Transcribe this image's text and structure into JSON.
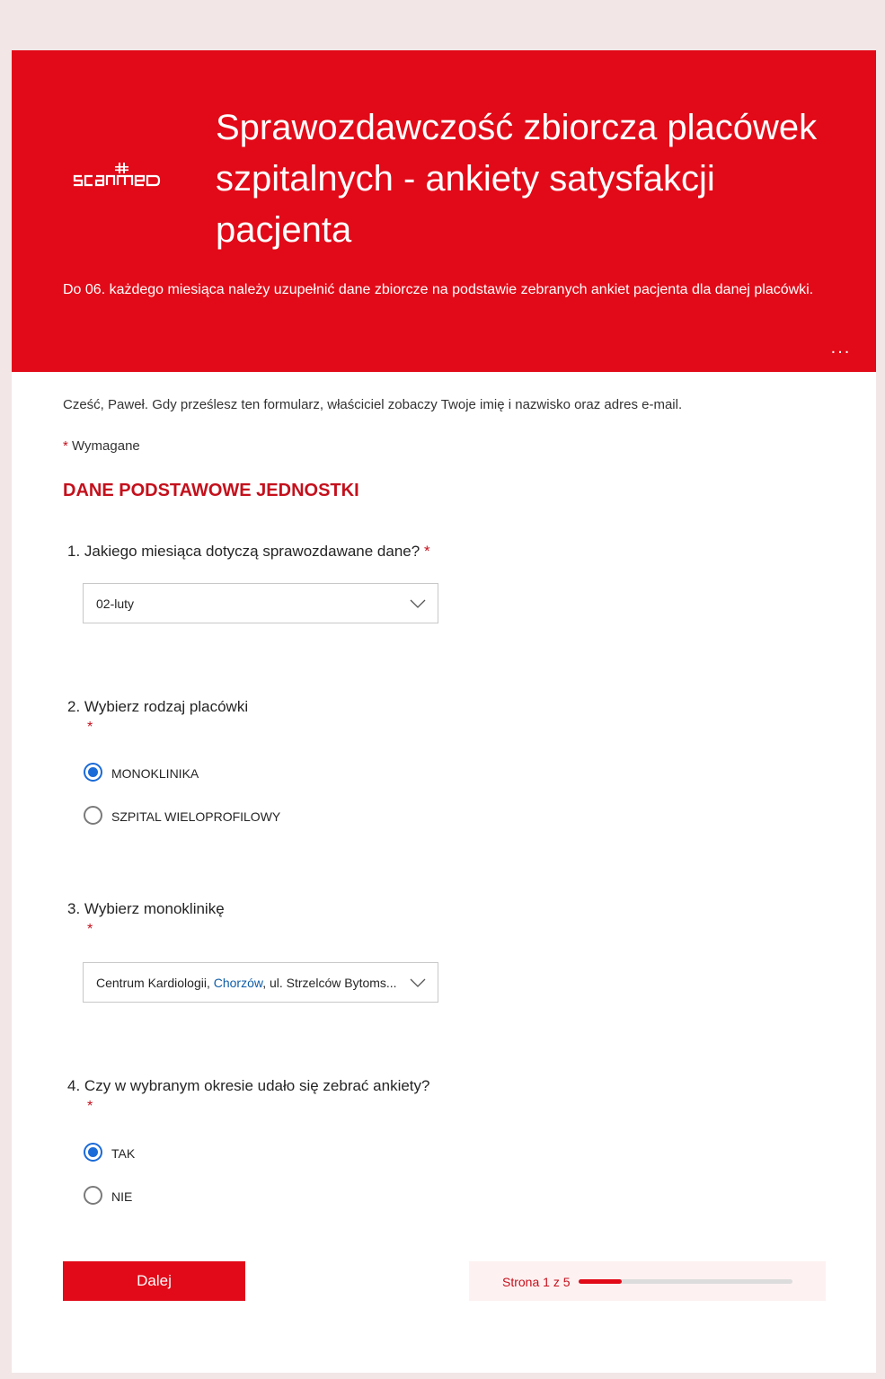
{
  "header": {
    "logo_text": "scanmed",
    "title": "Sprawozdawczość zbiorcza placówek szpitalnych - ankiety satysfakcji pacjenta",
    "description": "Do 06. każdego miesiąca należy uzupełnić dane zbiorcze na podstawie zebranych ankiet pacjenta dla danej placówki.",
    "more_label": "...",
    "accent_color": "#e20a18"
  },
  "intro": {
    "greeting": "Cześć, Paweł. Gdy prześlesz ten formularz, właściciel zobaczy Twoje imię i nazwisko oraz adres e-mail.",
    "required_star": "*",
    "required_label": "Wymagane"
  },
  "section_title": "DANE PODSTAWOWE JEDNOSTKI",
  "questions": [
    {
      "number": "1.",
      "text": "Jakiego miesiąca dotyczą sprawozdawane dane?",
      "star": "*",
      "answer": "02-luty"
    },
    {
      "number": "2.",
      "text": "Wybierz rodzaj placówki",
      "star": "*",
      "options": [
        {
          "label": "MONOKLINIKA",
          "checked": true
        },
        {
          "label": "SZPITAL WIELOPROFILOWY",
          "checked": false
        }
      ]
    },
    {
      "number": "3.",
      "text": "Wybierz monoklinikę",
      "star": "*",
      "answer_part1": "Centrum Kardiologii, ",
      "answer_link": "Chorzów",
      "answer_part2": ", ul. Strzelców Bytoms..."
    },
    {
      "number": "4.",
      "text": "Czy w wybranym okresie udało się zebrać ankiety?",
      "star": "*",
      "options": [
        {
          "label": "TAK",
          "checked": true
        },
        {
          "label": "NIE",
          "checked": false
        }
      ]
    }
  ],
  "footer": {
    "next_label": "Dalej",
    "progress_text": "Strona 1 z 5",
    "progress_fraction": 0.2
  }
}
